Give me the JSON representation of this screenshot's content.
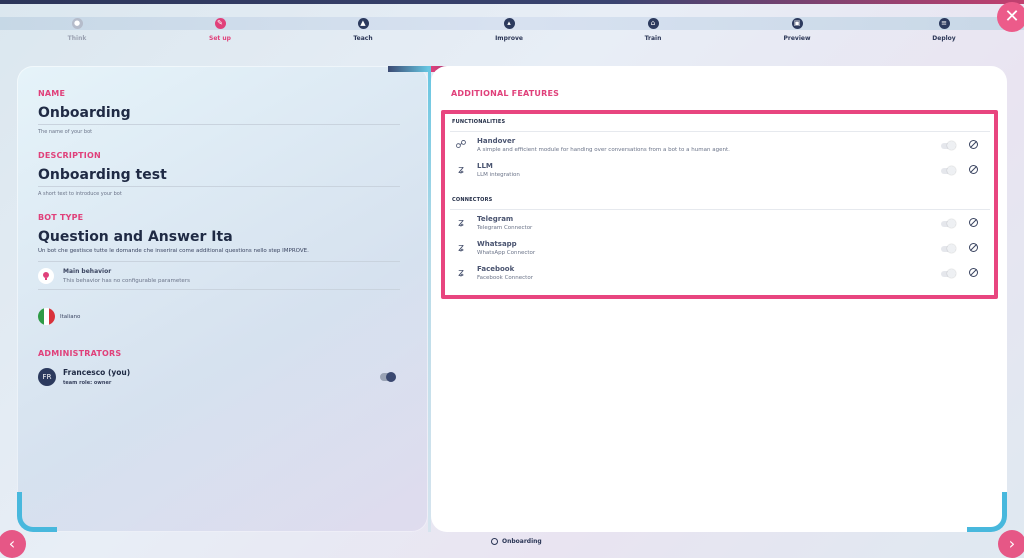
{
  "stepper": {
    "steps": [
      {
        "label": "Think",
        "icon": "lightbulb-icon",
        "state": "done"
      },
      {
        "label": "Set up",
        "icon": "pencil-icon",
        "state": "active"
      },
      {
        "label": "Teach",
        "icon": "cap-icon",
        "state": "todo"
      },
      {
        "label": "Improve",
        "icon": "chart-icon",
        "state": "todo"
      },
      {
        "label": "Train",
        "icon": "train-icon",
        "state": "todo"
      },
      {
        "label": "Preview",
        "icon": "preview-icon",
        "state": "todo"
      },
      {
        "label": "Deploy",
        "icon": "deploy-icon",
        "state": "todo"
      }
    ]
  },
  "left": {
    "name": {
      "title": "NAME",
      "value": "Onboarding",
      "hint": "The name of your bot"
    },
    "description": {
      "title": "DESCRIPTION",
      "value": "Onboarding test",
      "hint": "A short text to introduce your bot"
    },
    "bot_type": {
      "title": "BOT TYPE",
      "value": "Question and Answer Ita",
      "hint": "Un bot che gestisce tutte le domande che inserirai come additional questions nello step IMPROVE."
    },
    "behavior": {
      "title": "Main behavior",
      "desc": "This behavior has no configurable parameters"
    },
    "language": "Italiano",
    "administrators": {
      "title": "ADMINISTRATORS",
      "items": [
        {
          "initials": "FR",
          "name": "Francesco (you)",
          "role": "team role: owner",
          "enabled": true
        }
      ]
    }
  },
  "right": {
    "title": "ADDITIONAL FEATURES",
    "groups": [
      {
        "title": "FUNCTIONALITIES",
        "items": [
          {
            "name": "Handover",
            "desc": "A simple and efficient module for handing over conversations from a bot to a human agent.",
            "icon": "handshake-icon",
            "enabled": false
          },
          {
            "name": "LLM",
            "desc": "LLM integration",
            "icon": "plug-icon",
            "enabled": false
          }
        ]
      },
      {
        "title": "CONNECTORS",
        "items": [
          {
            "name": "Telegram",
            "desc": "Telegram Connector",
            "icon": "plug-icon",
            "enabled": false
          },
          {
            "name": "Whatsapp",
            "desc": "WhatsApp Connector",
            "icon": "plug-icon",
            "enabled": false
          },
          {
            "name": "Facebook",
            "desc": "Facebook Connector",
            "icon": "plug-icon",
            "enabled": false
          }
        ]
      }
    ]
  },
  "footer": {
    "label": "Onboarding"
  },
  "colors": {
    "accent": "#e0407a",
    "highlight": "#e8457f",
    "dark": "#2c3a5e",
    "cyan": "#48b8dd"
  }
}
